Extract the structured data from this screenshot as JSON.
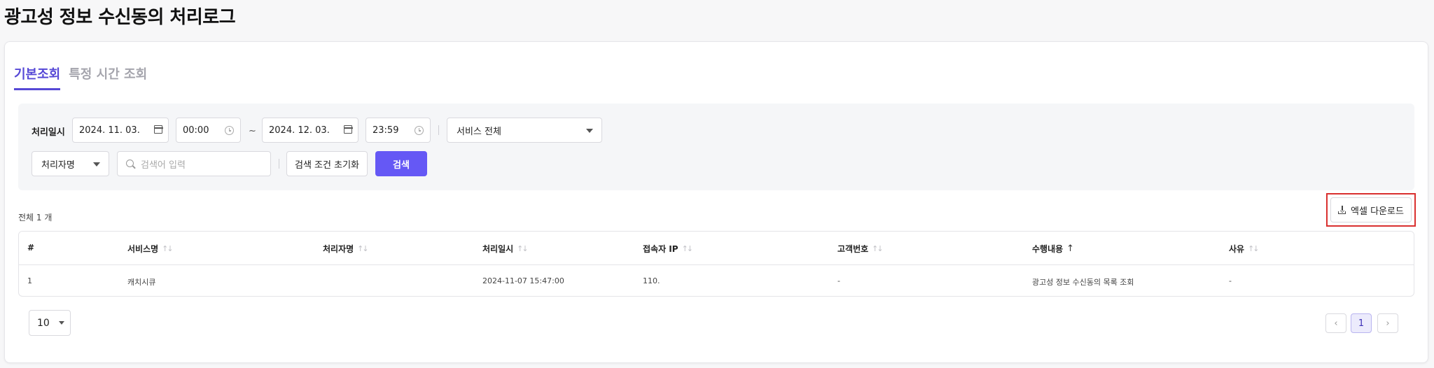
{
  "page": {
    "title": "광고성 정보 수신동의 처리로그"
  },
  "tabs": [
    {
      "label": "기본조회",
      "active": true
    },
    {
      "label": "특정 시간 조회",
      "active": false
    }
  ],
  "filters": {
    "date_label": "처리일시",
    "start_date": "2024. 11. 03.",
    "start_time": "00:00",
    "range_sep": "~",
    "end_date": "2024. 12. 03.",
    "end_time": "23:59",
    "service_select": "서비스 전체",
    "field_select": "처리자명",
    "search_placeholder": "검색어 입력",
    "reset_label": "검색 조건 초기화",
    "search_label": "검색"
  },
  "results": {
    "total_text": "전체 1 개",
    "excel_label": "엑셀 다운로드"
  },
  "table": {
    "columns": [
      "#",
      "서비스명",
      "처리자명",
      "처리일시",
      "접속자 IP",
      "고객번호",
      "수행내용",
      "사유"
    ],
    "sort_active_column": "수행내용",
    "rows": [
      [
        "1",
        "캐치시큐",
        "",
        "2024-11-07 15:47:00",
        "110.",
        "-",
        "광고성 정보 수신동의 목록 조회",
        "-"
      ]
    ]
  },
  "pagination": {
    "page_size": "10",
    "prev_icon": "chevron-left-icon",
    "next_icon": "chevron-right-icon",
    "pages": [
      "1"
    ],
    "current_page": "1"
  },
  "colors": {
    "accent": "#6558f5",
    "tab_active": "#5648d6",
    "highlight_border": "#d9302f"
  }
}
